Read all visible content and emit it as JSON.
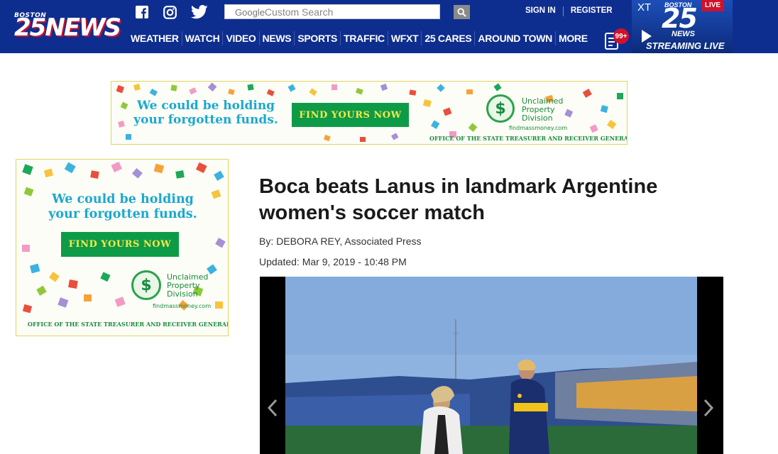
{
  "header": {
    "logo_small": "BOSTON",
    "logo_big": "25NEWS",
    "search_placeholder": "Custom Search",
    "search_google": "Google",
    "sign_in": "SIGN IN",
    "register": "REGISTER",
    "nav": [
      "WEATHER",
      "WATCH",
      "VIDEO",
      "NEWS",
      "SPORTS",
      "TRAFFIC",
      "WFXT",
      "25 CARES",
      "AROUND TOWN",
      "MORE"
    ],
    "notif_count": "99+",
    "stream": {
      "live": "LIVE",
      "xt": "XT",
      "s25": "25",
      "news": "NEWS",
      "boston": "BOSTON",
      "label": "STREAMING LIVE"
    }
  },
  "ads": {
    "msg_line1": "We could be holding",
    "msg_line2": "your forgotten funds.",
    "cta": "FIND YOURS NOW",
    "brand_line1": "Unclaimed",
    "brand_line2": "Property",
    "brand_line3": "Division",
    "site": "findmassmoney.com",
    "org": "OFFICE OF THE STATE TREASURER AND RECEIVER GENERAL",
    "seal": "$"
  },
  "article": {
    "headline": "Boca beats Lanus in landmark Argentine women's soccer match",
    "byline": "By: DEBORA REY, Associated Press",
    "updated": "Updated: Mar 9, 2019 - 10:48 PM"
  },
  "colors": {
    "header_bg": "#0e2e8f",
    "brand_red": "#c8102e",
    "ad_green": "#0e9b48",
    "ad_blue": "#1ba8d0"
  },
  "icons": [
    "facebook-icon",
    "instagram-icon",
    "twitter-icon",
    "search-icon",
    "notifications-icon",
    "play-icon",
    "chevron-left-icon",
    "chevron-right-icon"
  ]
}
